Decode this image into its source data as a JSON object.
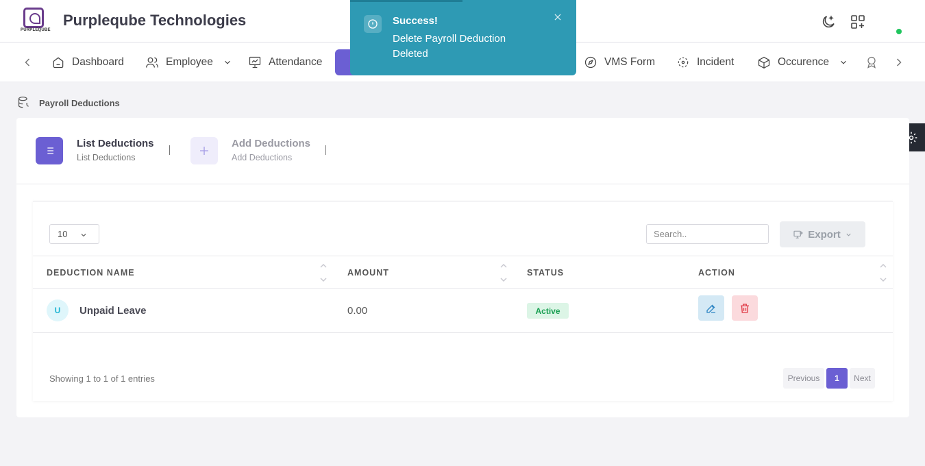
{
  "header": {
    "logo_text": "PURPLEQUBE",
    "company_name": "Purpleqube Technologies",
    "icons": [
      "moon-icon",
      "apps-add-icon"
    ]
  },
  "nav": {
    "items": [
      {
        "label": "Dashboard",
        "icon": "home-icon"
      },
      {
        "label": "Employee",
        "icon": "users-icon",
        "has_dropdown": true
      },
      {
        "label": "Attendance",
        "icon": "presentation-chart-icon"
      },
      {
        "label": "VMS Form",
        "icon": "compass-icon"
      },
      {
        "label": "Incident",
        "icon": "focus-icon"
      },
      {
        "label": "Occurence",
        "icon": "box-icon",
        "has_dropdown": true
      }
    ],
    "active_color": "#6b5fd3"
  },
  "toast": {
    "title": "Success!",
    "message": "Delete Payroll Deduction Deleted",
    "color": "#2e9ab4"
  },
  "breadcrumb": {
    "label": "Payroll Deductions"
  },
  "tabs": [
    {
      "title": "List Deductions",
      "subtitle": "List Deductions",
      "active": true
    },
    {
      "title": "Add Deductions",
      "subtitle": "Add Deductions",
      "active": false
    }
  ],
  "table_controls": {
    "page_length": "10",
    "search_placeholder": "Search..",
    "export_label": "Export"
  },
  "table": {
    "columns": [
      "DEDUCTION NAME",
      "AMOUNT",
      "STATUS",
      "ACTION"
    ],
    "rows": [
      {
        "avatar": "U",
        "name": "Unpaid Leave",
        "amount": "0.00",
        "status": "Active"
      }
    ]
  },
  "footer": {
    "info": "Showing 1 to 1 of 1 entries",
    "prev": "Previous",
    "page": "1",
    "next": "Next"
  }
}
